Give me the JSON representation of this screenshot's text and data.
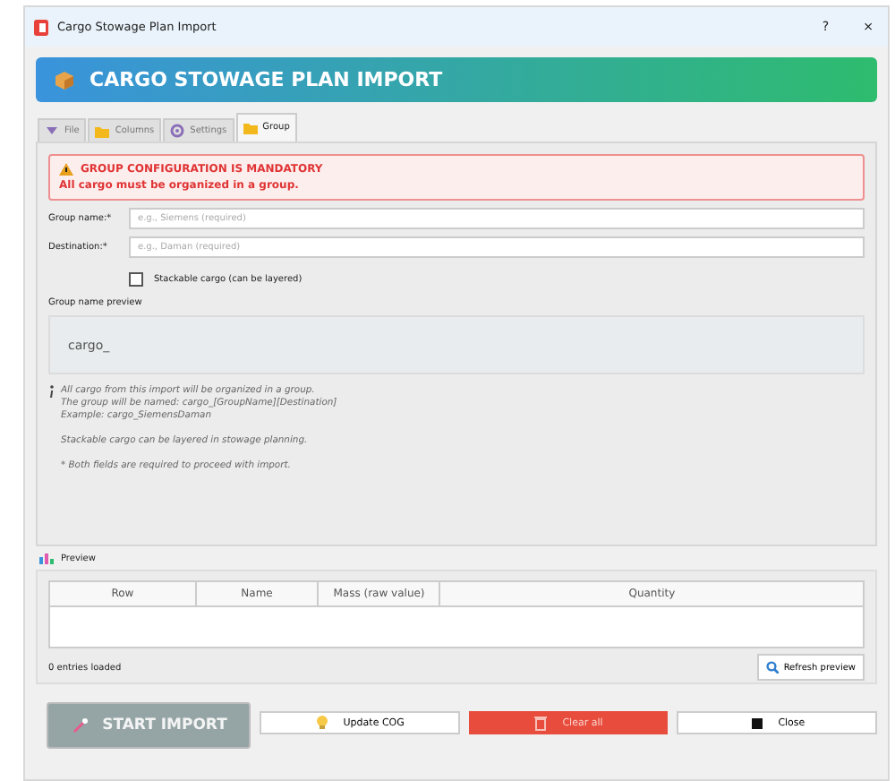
{
  "window": {
    "title": "Cargo Stowage Plan Import",
    "help": "?",
    "close": "×"
  },
  "header": {
    "title": "CARGO STOWAGE PLAN IMPORT"
  },
  "tabs": [
    {
      "label": "File",
      "selected": false
    },
    {
      "label": "Columns",
      "selected": false
    },
    {
      "label": "Settings",
      "selected": false
    },
    {
      "label": "Group",
      "selected": true
    }
  ],
  "alert": {
    "title": "GROUP CONFIGURATION IS MANDATORY",
    "message": "All cargo must be organized in a group."
  },
  "fields": [
    {
      "label": "Group name:*",
      "placeholder": "e.g., Siemens (required)"
    },
    {
      "label": "Destination:*",
      "placeholder": "e.g., Daman (required)"
    }
  ],
  "checkbox": {
    "label": "Stackable cargo (can be layered)",
    "checked": false
  },
  "name_preview": {
    "label": "Group name preview",
    "value": "cargo_"
  },
  "info": [
    [
      "All cargo from this import will be organized in a group.",
      "The group will be named: cargo_[GroupName][Destination]",
      "Example: cargo_SiemensDaman"
    ],
    [
      "Stackable cargo can be layered in stowage planning."
    ],
    [
      "* Both fields are required to proceed with import."
    ]
  ],
  "preview": {
    "title": "Preview",
    "columns": [
      "Row",
      "Name",
      "Mass (raw value)",
      "Quantity"
    ],
    "status": "0 entries loaded",
    "refresh_button": "Refresh preview"
  },
  "actions": [
    {
      "label": "START IMPORT",
      "kind": "primary"
    },
    {
      "label": "Update COG",
      "kind": "secondary"
    },
    {
      "label": "Clear all",
      "kind": "danger"
    },
    {
      "label": "Close",
      "kind": "secondary"
    }
  ]
}
